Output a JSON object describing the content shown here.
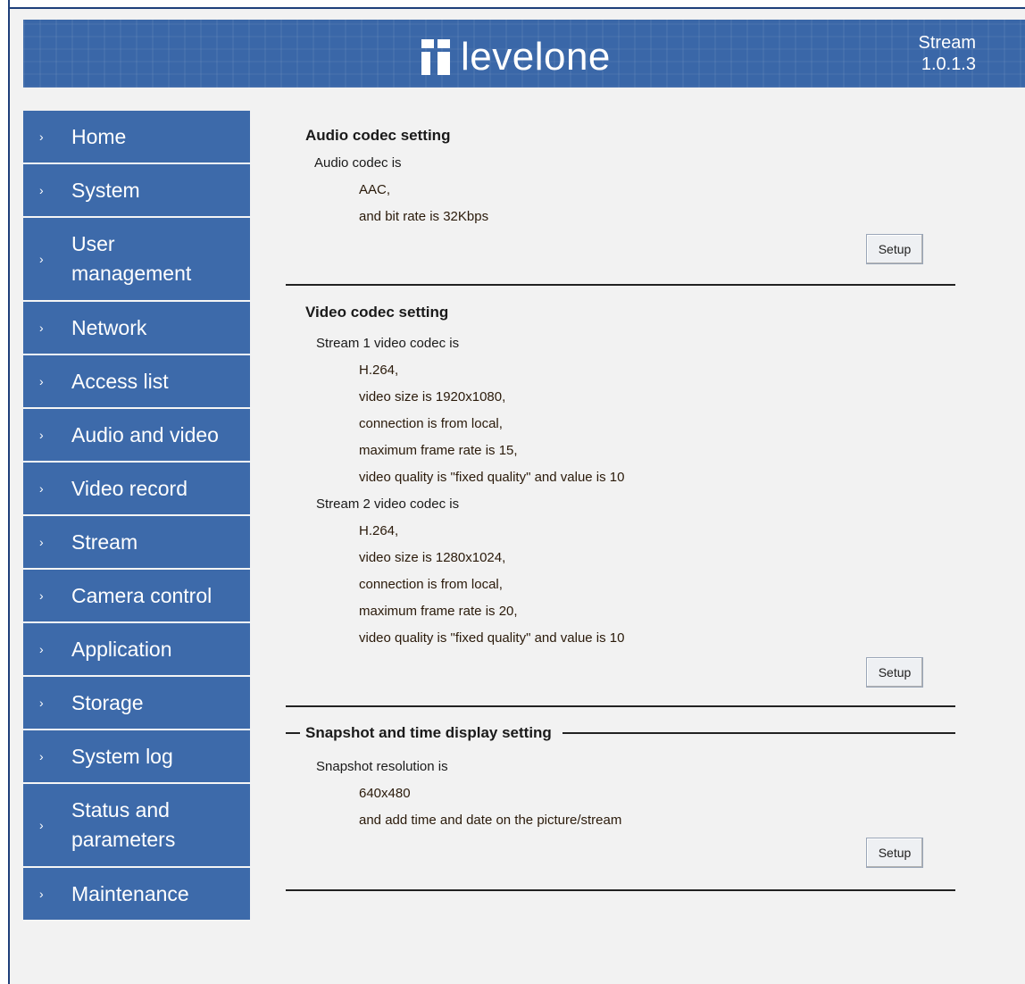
{
  "header": {
    "logo_text": "levelone",
    "version_line1": "Stream",
    "version_line2": "1.0.1.3"
  },
  "sidebar": {
    "items": [
      {
        "label": "Home",
        "lines": [
          "Home"
        ]
      },
      {
        "label": "System",
        "lines": [
          "System"
        ]
      },
      {
        "label": "User management",
        "lines": [
          "User",
          "management"
        ]
      },
      {
        "label": "Network",
        "lines": [
          "Network"
        ]
      },
      {
        "label": "Access list",
        "lines": [
          "Access list"
        ]
      },
      {
        "label": "Audio and video",
        "lines": [
          "Audio and video"
        ]
      },
      {
        "label": "Video record",
        "lines": [
          "Video record"
        ]
      },
      {
        "label": "Stream",
        "lines": [
          "Stream"
        ]
      },
      {
        "label": "Camera control",
        "lines": [
          "Camera control"
        ]
      },
      {
        "label": "Application",
        "lines": [
          "Application"
        ]
      },
      {
        "label": "Storage",
        "lines": [
          "Storage"
        ]
      },
      {
        "label": "System log",
        "lines": [
          "System log"
        ]
      },
      {
        "label": "Status and parameters",
        "lines": [
          "Status and",
          "parameters"
        ]
      },
      {
        "label": "Maintenance",
        "lines": [
          "Maintenance"
        ]
      }
    ]
  },
  "audio": {
    "title": "Audio codec setting",
    "intro": "Audio codec is",
    "codec": "AAC,",
    "bitrate": "and bit rate is 32Kbps",
    "setup_label": "Setup"
  },
  "video": {
    "title": "Video codec setting",
    "stream1": {
      "intro": "Stream 1 video codec is",
      "codec": "H.264,",
      "size": "video size is 1920x1080,",
      "connection": "connection is from local,",
      "framerate": "maximum frame rate is 15,",
      "quality": "video quality is \"fixed quality\" and value is 10"
    },
    "stream2": {
      "intro": "Stream 2 video codec is",
      "codec": "H.264,",
      "size": "video size is 1280x1024,",
      "connection": "connection is from local,",
      "framerate": "maximum frame rate is 20,",
      "quality": "video quality is \"fixed quality\" and value is 10"
    },
    "setup_label": "Setup"
  },
  "snapshot": {
    "title": "Snapshot and time display setting",
    "intro": "Snapshot resolution is",
    "resolution": "640x480",
    "overlay": "and add time and date on the picture/stream",
    "setup_label": "Setup"
  },
  "colors": {
    "nav_bg": "#3d6aaa",
    "header_bg": "#3a67a8",
    "page_bg": "#f2f2f2"
  }
}
